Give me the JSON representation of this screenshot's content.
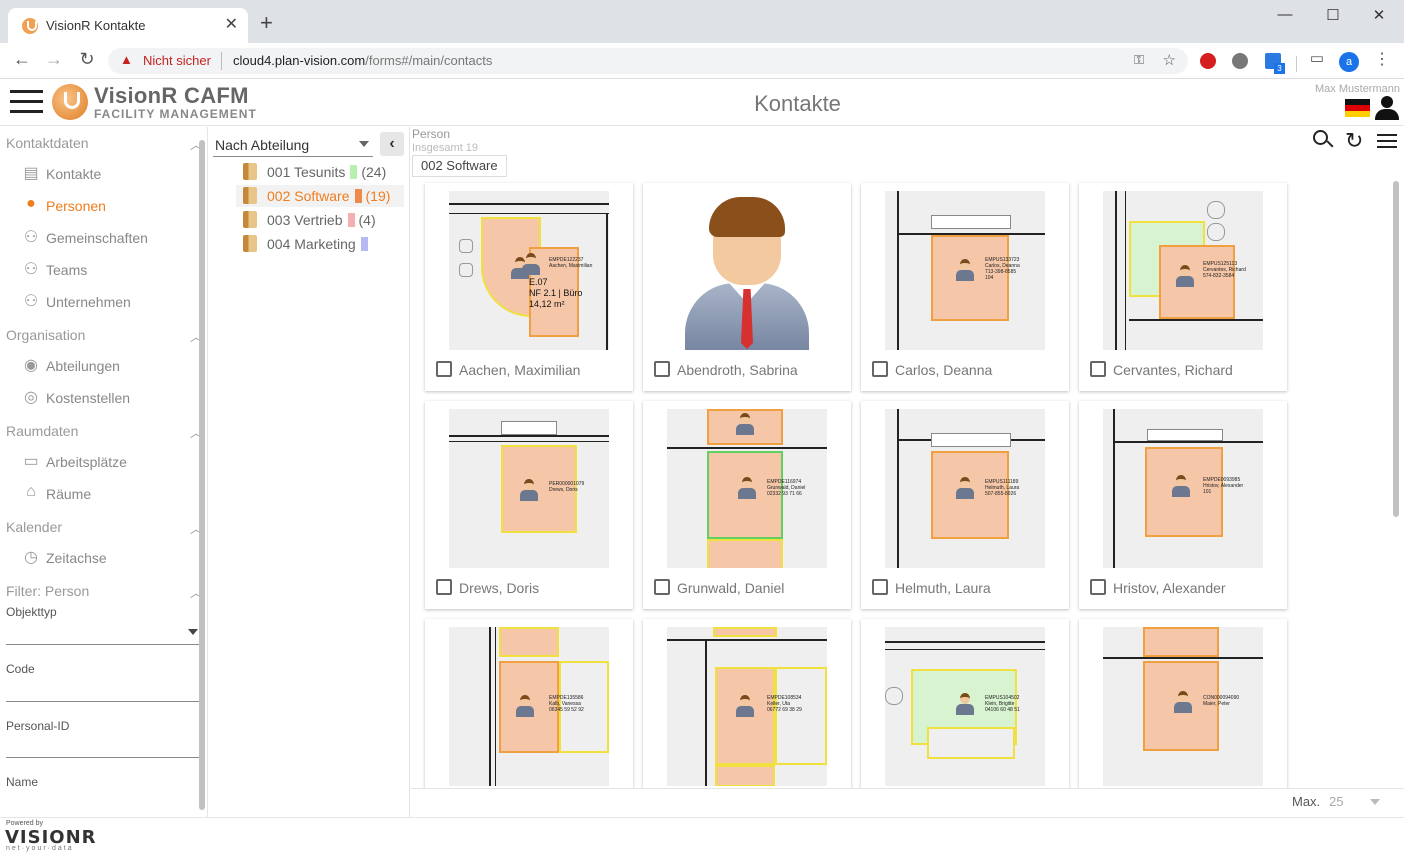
{
  "browser": {
    "tab_title": "VisionR Kontakte",
    "security_label": "Nicht sicher",
    "url_host": "cloud4.plan-vision.com",
    "url_path": "/forms#/main/contacts",
    "extension_badge": "3",
    "profile_initial": "a"
  },
  "header": {
    "brand": "VisionR CAFM",
    "brand_sub": "FACILITY MANAGEMENT",
    "page_title": "Kontakte",
    "user_name": "Max Mustermann"
  },
  "sidebar": {
    "sections": [
      {
        "label": "Kontaktdaten",
        "items": [
          {
            "label": "Kontakte",
            "icon": "contact-card-icon"
          },
          {
            "label": "Personen",
            "icon": "person-icon",
            "active": true
          },
          {
            "label": "Gemeinschaften",
            "icon": "group-icon"
          },
          {
            "label": "Teams",
            "icon": "group-icon"
          },
          {
            "label": "Unternehmen",
            "icon": "group-icon"
          }
        ]
      },
      {
        "label": "Organisation",
        "items": [
          {
            "label": "Abteilungen",
            "icon": "department-icon"
          },
          {
            "label": "Kostenstellen",
            "icon": "cost-center-icon"
          }
        ]
      },
      {
        "label": "Raumdaten",
        "items": [
          {
            "label": "Arbeitsplätze",
            "icon": "workstation-icon"
          },
          {
            "label": "Räume",
            "icon": "home-icon"
          }
        ]
      },
      {
        "label": "Kalender",
        "items": [
          {
            "label": "Zeitachse",
            "icon": "clock-icon"
          }
        ]
      }
    ],
    "filter": {
      "title": "Filter: Person",
      "fields": [
        "Objekttyp",
        "Code",
        "Personal-ID",
        "Name"
      ]
    }
  },
  "tree": {
    "group_by": "Nach Abteilung",
    "nodes": [
      {
        "label": "001 Tesunits",
        "count": "(24)",
        "color": "#b8f0b0"
      },
      {
        "label": "002 Software",
        "count": "(19)",
        "color": "#f08a4a",
        "selected": true
      },
      {
        "label": "003 Vertrieb",
        "count": "(4)",
        "color": "#f4b0b0"
      },
      {
        "label": "004 Marketing",
        "count": "",
        "color": "#b8b8f4"
      }
    ]
  },
  "main": {
    "entity": "Person",
    "total": "Insgesamt 19",
    "filter_chip": "002 Software",
    "cards": [
      {
        "name": "Aachen, Maximilian",
        "code": "EMPDE122237",
        "line2": "Aachen, Maximilian",
        "line3": "E.07",
        "line4": "NF 2.1 | Büro",
        "line5": "14,12 m²"
      },
      {
        "name": "Abendroth, Sabrina"
      },
      {
        "name": "Carlos, Deanna",
        "code": "EMPUS133723",
        "line2": "Carlos, Deanna",
        "line3": "713-398-8585",
        "line4": "104"
      },
      {
        "name": "Cervantes, Richard",
        "code": "EMPUS125113",
        "line2": "Cervantes, Richard",
        "line3": "574-832-3584"
      },
      {
        "name": "Drews, Doris",
        "code": "PER000001079",
        "line2": "Drews, Doris"
      },
      {
        "name": "Grunwald, Daniel",
        "code": "EMPDE116974",
        "line2": "Grunwald, Daniel",
        "line3": "02332 93 71 66"
      },
      {
        "name": "Helmuth, Laura",
        "code": "EMPUS111189",
        "line2": "Helmuth, Laura",
        "line3": "507-855-8926"
      },
      {
        "name": "Hristov, Alexander",
        "code": "EMPDE0093985",
        "line2": "Hristov, Alexander",
        "line3": "101"
      },
      {
        "name": "",
        "code": "EMPDE135586",
        "line2": "Kalb, Vanessa",
        "line3": "06345 59 52 92"
      },
      {
        "name": "",
        "code": "EMPDE108534",
        "line2": "Keller, Uta",
        "line3": "06772 69 38 29"
      },
      {
        "name": "",
        "code": "EMPUS104502",
        "line2": "Klein, Brigitte",
        "line3": "04106 60 48 51"
      },
      {
        "name": "",
        "code": "CON000094090",
        "line2": "Maier, Peter"
      }
    ],
    "max_label": "Max.",
    "max_value": "25"
  },
  "footer": {
    "powered": "Powered by",
    "logo": "VISIONR",
    "tagline": "net·your·data"
  }
}
